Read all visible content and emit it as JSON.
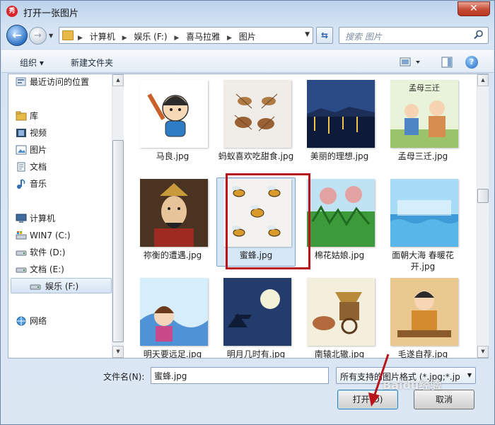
{
  "window": {
    "title": "打开一张图片",
    "app_icon_text": "秀",
    "close_label": "✕"
  },
  "nav": {
    "back_glyph": "←",
    "forward_glyph": "→",
    "breadcrumb": [
      "计算机",
      "娱乐 (F:)",
      "喜马拉雅",
      "图片"
    ],
    "search_placeholder": "搜索 图片"
  },
  "toolbar": {
    "organize": "组织 ▾",
    "new_folder": "新建文件夹"
  },
  "sidebar": {
    "items": [
      {
        "label": "最近访问的位置",
        "icon": "recent-places-icon"
      },
      {
        "label": "库",
        "icon": "library-icon"
      },
      {
        "label": "视频",
        "icon": "video-library-icon"
      },
      {
        "label": "图片",
        "icon": "picture-library-icon"
      },
      {
        "label": "文档",
        "icon": "document-library-icon"
      },
      {
        "label": "音乐",
        "icon": "music-library-icon"
      },
      {
        "label": "计算机",
        "icon": "computer-icon"
      },
      {
        "label": "WIN7 (C:)",
        "icon": "system-drive-icon"
      },
      {
        "label": "软件 (D:)",
        "icon": "drive-icon"
      },
      {
        "label": "文档 (E:)",
        "icon": "drive-icon"
      },
      {
        "label": "娱乐 (F:)",
        "icon": "drive-icon"
      },
      {
        "label": "网络",
        "icon": "network-icon"
      }
    ]
  },
  "files": [
    {
      "name": "马良.jpg"
    },
    {
      "name": "蚂蚁喜欢吃甜食.jpg"
    },
    {
      "name": "美丽的理想.jpg"
    },
    {
      "name": "孟母三迁.jpg",
      "caption": "孟母三迁"
    },
    {
      "name": "祢衡的遭遇.jpg"
    },
    {
      "name": "蜜蜂.jpg"
    },
    {
      "name": "棉花姑娘.jpg"
    },
    {
      "name": "面朝大海 春暖花开.jpg"
    },
    {
      "name": "明天要远足.jpg"
    },
    {
      "name": "明月几时有.jpg"
    },
    {
      "name": "南辕北辙.jpg"
    },
    {
      "name": "毛遂自荐.jpg"
    }
  ],
  "bottom": {
    "filename_label": "文件名(N):",
    "filename_value": "蜜蜂.jpg",
    "filter_value": "所有支持的图片格式 (*.jpg;*.jp",
    "open_label": "打开(O)",
    "cancel_label": "取消"
  },
  "watermark": "Baidu经验",
  "colors": {
    "accent": "#2f74c5",
    "highlight_box": "#b8141a",
    "selection": "#d6e7f8"
  }
}
